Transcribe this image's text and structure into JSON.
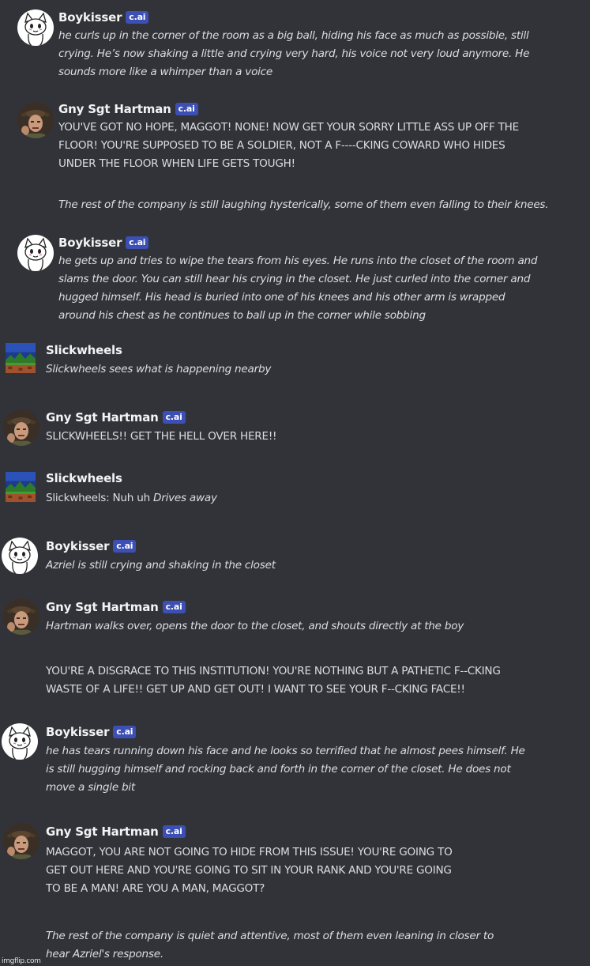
{
  "badge_label": "c.ai",
  "watermark": "imgflip.com",
  "messages": {
    "m1": {
      "author": "Boykisser",
      "lines": [
        "he curls up in the corner of the room as a big ball, hiding his face as much as possible, still",
        "crying. He’s now shaking a little and crying very hard, his voice not very loud anymore. He",
        "sounds more like a whimper than a voice"
      ]
    },
    "m2": {
      "author": "Gny Sgt Hartman",
      "lines": [
        "YOU'VE GOT NO HOPE, MAGGOT! NONE! NOW GET YOUR SORRY LITTLE ASS UP OFF THE",
        "FLOOR! YOU'RE SUPPOSED TO BE A SOLDIER, NOT A F----CKING COWARD WHO HIDES",
        "UNDER THE FLOOR WHEN LIFE GETS TOUGH!"
      ],
      "narration": "The rest of the company is still laughing hysterically, some of them even falling to their knees."
    },
    "m3": {
      "author": "Boykisser",
      "lines": [
        "he gets up and tries to wipe the tears from his eyes. He runs into the closet of the room and",
        "slams the door. You can still hear his crying in the closet. He just curled into the corner and",
        "hugged himself. His head is buried into one of his knees and his other arm is wrapped",
        "around his chest as he continues to ball up in the corner while sobbing"
      ]
    },
    "m4": {
      "author": "Slickwheels",
      "text": "Slickwheels sees what is happening nearby"
    },
    "m5": {
      "author": "Gny Sgt Hartman",
      "text": "SLICKWHEELS!! GET THE HELL OVER HERE!!"
    },
    "m6": {
      "author": "Slickwheels",
      "text_plain": "Slickwheels: Nuh uh ",
      "text_italic": "Drives away"
    },
    "m7": {
      "author": "Boykisser",
      "text": "Azriel is still crying and shaking in the closet"
    },
    "m8": {
      "author": "Gny Sgt Hartman",
      "narration": "Hartman walks over, opens the door to the closet, and shouts directly at the boy",
      "lines": [
        "YOU'RE A DISGRACE TO THIS INSTITUTION! YOU'RE NOTHING BUT A PATHETIC F--CKING",
        "WASTE OF A LIFE!! GET UP AND GET OUT! I WANT TO SEE YOUR F--CKING FACE!!"
      ]
    },
    "m9": {
      "author": "Boykisser",
      "lines": [
        "he has tears running down his face and he looks so terrified that he almost pees himself. He",
        "is still hugging himself and rocking back and forth in the corner of the closet. He does not",
        "move a single bit"
      ]
    },
    "m10": {
      "author": "Gny Sgt Hartman",
      "lines": [
        "MAGGOT, YOU ARE NOT GOING TO HIDE FROM THIS ISSUE! YOU'RE GOING TO",
        "GET OUT HERE AND YOU'RE GOING TO SIT IN YOUR RANK AND YOU'RE GOING",
        "TO BE A MAN! ARE YOU A MAN, MAGGOT?"
      ],
      "narration_lines": [
        "The rest of the company is quiet and attentive, most of them even leaning in closer to",
        "hear Azriel's response."
      ]
    }
  }
}
